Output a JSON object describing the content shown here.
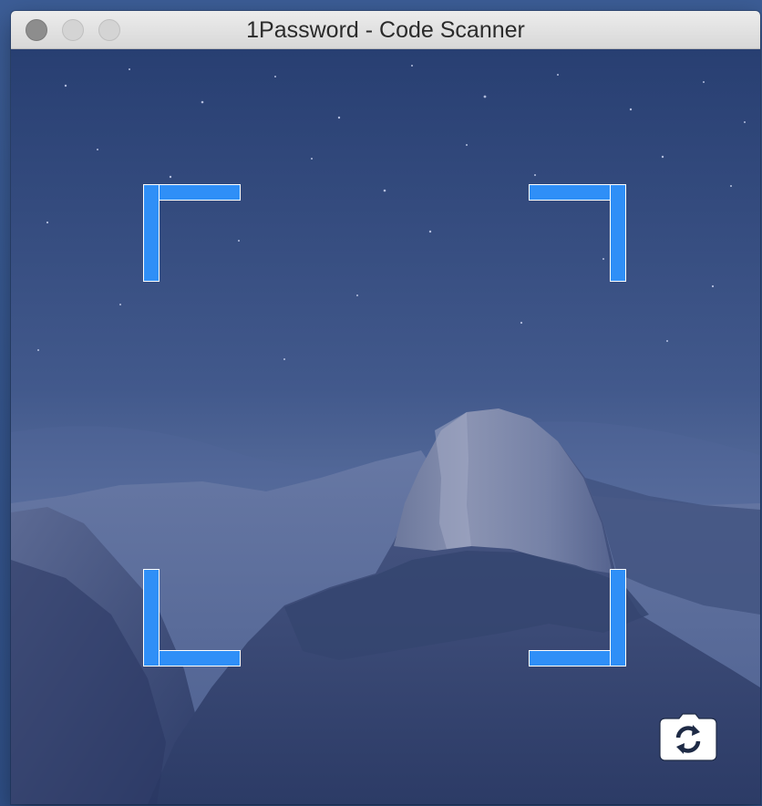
{
  "window": {
    "title": "1Password - Code Scanner"
  },
  "scanner": {
    "switch_camera_icon": "camera-switch-icon"
  },
  "colors": {
    "bracket": "#2f8ff7",
    "bracket_outline": "#ffffff",
    "titlebar": "#e2e2e2",
    "close_button": "#8d8d8d"
  }
}
